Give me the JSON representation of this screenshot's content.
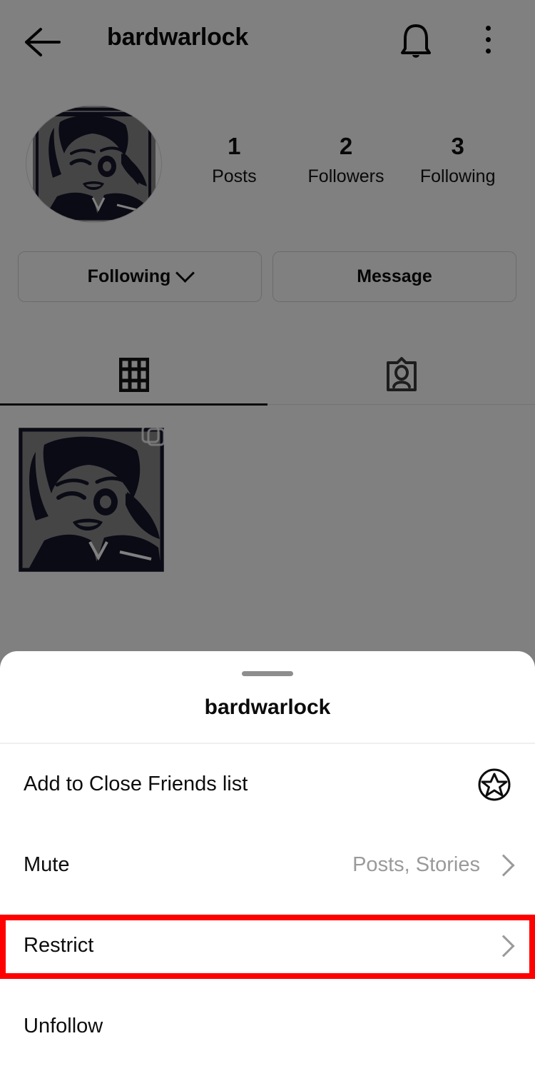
{
  "header": {
    "back_icon": "back-arrow-icon",
    "username": "bardwarlock",
    "bell_icon": "bell-icon",
    "menu_icon": "three-dots-vertical-icon"
  },
  "profile": {
    "avatar_alt": "anime-character-avatar",
    "stats": [
      {
        "value": "1",
        "label": "Posts"
      },
      {
        "value": "2",
        "label": "Followers"
      },
      {
        "value": "3",
        "label": "Following"
      }
    ],
    "buttons": {
      "following_label": "Following",
      "message_label": "Message"
    },
    "tabs": [
      {
        "name": "grid-tab",
        "icon": "grid-icon",
        "active": true
      },
      {
        "name": "tagged-tab",
        "icon": "tagged-person-icon",
        "active": false
      }
    ],
    "posts": [
      {
        "alt": "anime-character-post",
        "badge": "carousel-icon"
      }
    ]
  },
  "sheet": {
    "title": "bardwarlock",
    "handle": "drag-handle",
    "items": [
      {
        "label": "Add to Close Friends list",
        "value": "",
        "trailing": "star-circle-icon",
        "highlighted": false
      },
      {
        "label": "Mute",
        "value": "Posts, Stories",
        "trailing": "chevron-right-icon",
        "highlighted": false
      },
      {
        "label": "Restrict",
        "value": "",
        "trailing": "chevron-right-icon",
        "highlighted": true
      },
      {
        "label": "Unfollow",
        "value": "",
        "trailing": "none",
        "highlighted": false
      }
    ]
  },
  "colors": {
    "highlight": "#fe0000",
    "scrim": "#808080",
    "muted_text": "#9a9a9a"
  }
}
